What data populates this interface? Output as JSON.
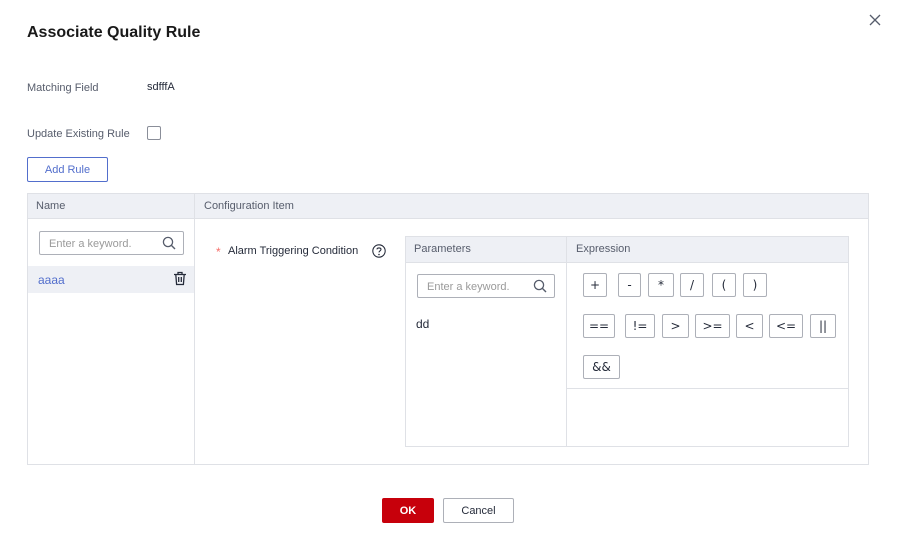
{
  "dialog": {
    "title": "Associate Quality Rule"
  },
  "form": {
    "matching_field_label": "Matching Field",
    "matching_field_value": "sdfffA",
    "update_existing_label": "Update Existing Rule",
    "update_existing_checked": false,
    "add_rule_label": "Add Rule"
  },
  "rules_table": {
    "col_name": "Name",
    "col_config": "Configuration Item",
    "search_placeholder": "Enter a keyword.",
    "items": [
      {
        "name": "aaaa"
      }
    ]
  },
  "config": {
    "condition_label": "Alarm Triggering Condition",
    "required_mark": "*",
    "parameters_header": "Parameters",
    "expression_header": "Expression",
    "param_search_placeholder": "Enter a keyword.",
    "parameters": [
      "dd"
    ],
    "operators": [
      "+",
      "-",
      "*",
      "/",
      "(",
      ")",
      "==",
      "!=",
      ">",
      ">=",
      "<",
      "<=",
      "||",
      "&&"
    ]
  },
  "footer": {
    "ok_label": "OK",
    "cancel_label": "Cancel"
  },
  "colors": {
    "primary": "#526ecc",
    "danger": "#c7000b",
    "header_bg": "#eef0f5",
    "border": "#dfe1e6"
  }
}
